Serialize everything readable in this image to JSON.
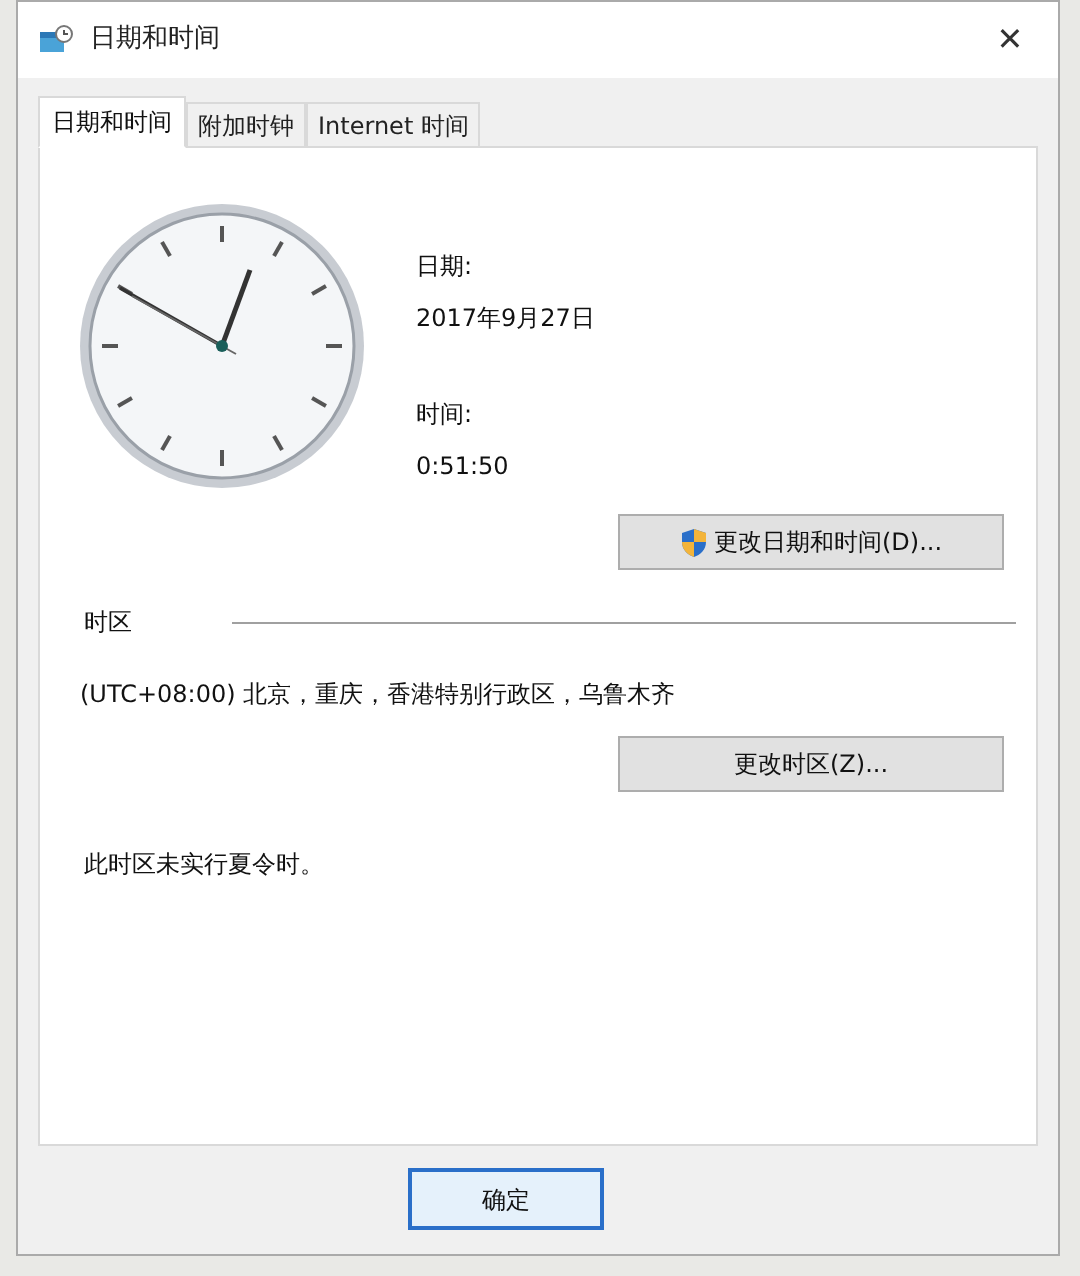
{
  "window": {
    "title": "日期和时间",
    "close": "✕"
  },
  "tabs": [
    {
      "label": "日期和时间",
      "selected": true
    },
    {
      "label": "附加时钟",
      "selected": false
    },
    {
      "label": "Internet 时间",
      "selected": false
    }
  ],
  "date": {
    "label": "日期:",
    "value": "2017年9月27日"
  },
  "time": {
    "label": "时间:",
    "value": "0:51:50"
  },
  "change_datetime_button": "更改日期和时间(D)...",
  "timezone": {
    "heading": "时区",
    "value": "(UTC+08:00) 北京，重庆，香港特别行政区，乌鲁木齐",
    "button": "更改时区(Z)...",
    "dst_note": "此时区未实行夏令时。"
  },
  "buttons": [
    {
      "label": "确定",
      "selected": true
    }
  ]
}
